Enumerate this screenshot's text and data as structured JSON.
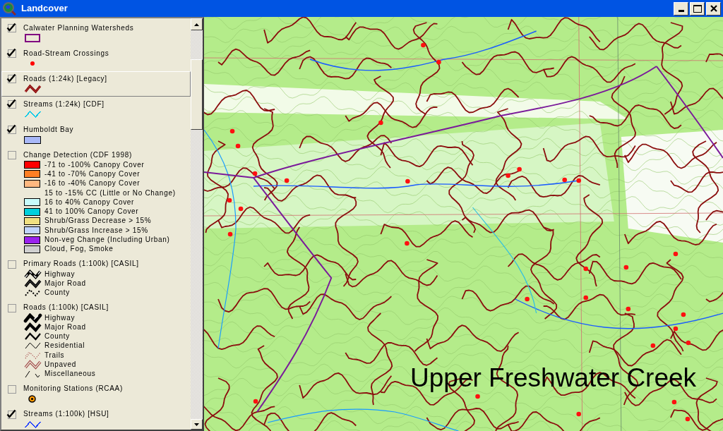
{
  "window": {
    "title": "Landcover"
  },
  "legend": {
    "layers": [
      {
        "name": "Calwater Planning Watersheds",
        "checked": true,
        "selected": false,
        "symbol": {
          "kind": "outline",
          "color": "#800080"
        }
      },
      {
        "name": "Road-Stream Crossings",
        "checked": true,
        "selected": false,
        "symbol": {
          "kind": "dot",
          "color": "#ff0000"
        }
      },
      {
        "name": "Roads (1:24k) [Legacy]",
        "checked": true,
        "selected": true,
        "symbol": {
          "kind": "double-line",
          "color": "#8b0a0a"
        }
      },
      {
        "name": "Streams (1:24k) [CDF]",
        "checked": true,
        "selected": false,
        "symbol": {
          "kind": "line",
          "color": "#00c8e8"
        }
      },
      {
        "name": "Humboldt Bay",
        "checked": true,
        "selected": false,
        "symbol": {
          "kind": "fill",
          "color": "#a8b8f8"
        }
      },
      {
        "name": "Change Detection (CDF 1998)",
        "checked": false,
        "selected": false,
        "classes": [
          {
            "label": "-71 to -100% Canopy Cover",
            "kind": "fill",
            "color": "#ff0000"
          },
          {
            "label": "-41 to -70% Canopy Cover",
            "kind": "fill",
            "color": "#ff7f24"
          },
          {
            "label": "-16 to -40% Canopy Cover",
            "kind": "fill",
            "color": "#ffb880"
          },
          {
            "label": "15 to -15% CC (Little or No Change)",
            "kind": "blank"
          },
          {
            "label": "16 to 40% Canopy Cover",
            "kind": "fill",
            "color": "#c8fcfc"
          },
          {
            "label": "41 to 100% Canopy Cover",
            "kind": "fill",
            "color": "#00d0dc"
          },
          {
            "label": "Shrub/Grass Decrease > 15%",
            "kind": "fill",
            "color": "#f0e080"
          },
          {
            "label": "Shrub/Grass Increase > 15%",
            "kind": "fill",
            "color": "#c0d4fc"
          },
          {
            "label": "Non-veg Change (Including Urban)",
            "kind": "fill",
            "color": "#9a22ee"
          },
          {
            "label": "Cloud, Fog, Smoke",
            "kind": "fill",
            "color": "#d0d0d0"
          }
        ]
      },
      {
        "name": "Primary Roads (1:100k) [CASIL]",
        "checked": false,
        "selected": false,
        "classes": [
          {
            "label": "Highway",
            "kind": "highway"
          },
          {
            "label": "Major Road",
            "kind": "major-road"
          },
          {
            "label": "County",
            "kind": "county-dashed"
          }
        ]
      },
      {
        "name": "Roads (1:100k) [CASIL]",
        "checked": false,
        "selected": false,
        "classes": [
          {
            "label": "Highway",
            "kind": "highway-wide"
          },
          {
            "label": "Major Road",
            "kind": "major-road-wide"
          },
          {
            "label": "County",
            "kind": "county"
          },
          {
            "label": "Residential",
            "kind": "residential"
          },
          {
            "label": "Trails",
            "kind": "trails"
          },
          {
            "label": "Unpaved",
            "kind": "unpaved"
          },
          {
            "label": "Miscellaneous",
            "kind": "misc"
          }
        ]
      },
      {
        "name": "Monitoring Stations (RCAA)",
        "checked": false,
        "selected": false,
        "symbol": {
          "kind": "station"
        }
      },
      {
        "name": "Streams (1:100k) [HSU]",
        "checked": true,
        "selected": false,
        "symbol": {
          "kind": "line",
          "color": "#2040ff"
        }
      }
    ]
  },
  "map": {
    "label": "Upper Freshwater Creek"
  }
}
